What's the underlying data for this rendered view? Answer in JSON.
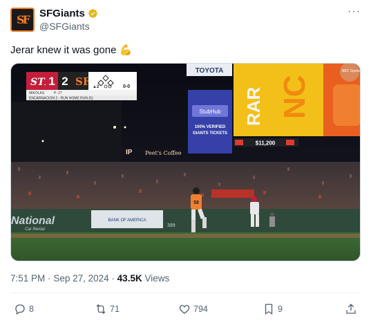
{
  "account": {
    "display_name": "SFGiants",
    "handle": "@SFGiants",
    "logo_letters": "SF"
  },
  "tweet": {
    "text": "Jerar knew it was gone",
    "emoji": "💪"
  },
  "media": {
    "scoreboard": {
      "away_abbr": "STL",
      "away_score": "1",
      "home_score": "2",
      "inning": "▲2",
      "count": "0-0",
      "pitcher": "MIKOLAS",
      "pitch_count": "P: 27",
      "caption": "ENCARNACION 2 - RUN HOME RUN (5)"
    },
    "signs": {
      "toyota": "TOYOTA",
      "stubhub": "StubHub",
      "stubhub_line1": "100% VERIFIED",
      "stubhub_line2": "GIANTS TICKETS",
      "rar": "RAR",
      "price": "$11,200",
      "ip": "IP",
      "peets": "Peet's Coffee",
      "national": "National",
      "car_rental": "Car Rental",
      "bofa": "BANK OF AMERICA",
      "distance": "399",
      "network": "NBC Sports"
    },
    "player_number": "58"
  },
  "meta": {
    "time": "7:51 PM",
    "separator": "·",
    "date": "Sep 27, 2024",
    "views_count": "43.5K",
    "views_label": "Views"
  },
  "actions": {
    "replies": "8",
    "reposts": "71",
    "likes": "794",
    "bookmarks": "9"
  },
  "colors": {
    "giants_orange": "#f47b20",
    "cardinals_red": "#c41e3a",
    "secondary_text": "#536471"
  }
}
